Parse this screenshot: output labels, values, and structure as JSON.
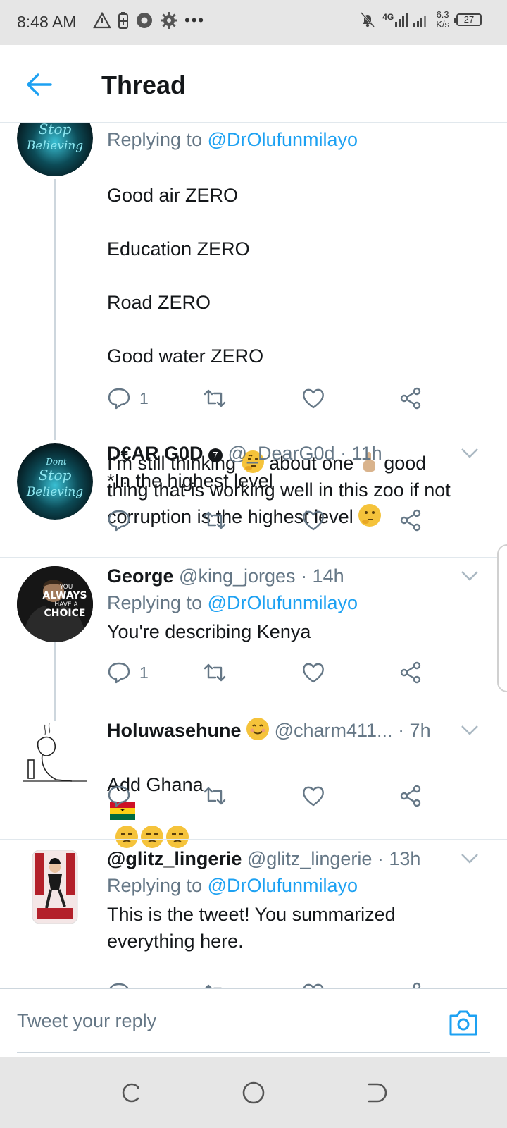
{
  "status_bar": {
    "time": "8:48 AM",
    "network": "4G",
    "speed_value": "6.3",
    "speed_unit": "K/s",
    "battery": "27"
  },
  "header": {
    "title": "Thread"
  },
  "tweets": [
    {
      "reply_prefix": "Replying to",
      "reply_handle": "@DrOlufunmilayo",
      "lines": [
        "Good air ZERO",
        "Education ZERO",
        "Road ZERO",
        "Good water ZERO"
      ],
      "para_a": "I’m still thinking",
      "para_b": "about one",
      "para_c": "good thing that is working well in this zoo if not corruption is the highest level",
      "reply_count": "1"
    },
    {
      "name": "D€AR G0D",
      "handle": "@_DearG0d",
      "time": "· 11h",
      "text": "*In the highest level",
      "reply_count": ""
    },
    {
      "name": "George",
      "handle": "@king_jorges",
      "time": "· 14h",
      "reply_prefix": "Replying to",
      "reply_handle": "@DrOlufunmilayo",
      "text": "You're describing Kenya",
      "reply_count": "1",
      "avatar_text": [
        "YOU",
        "ALWAYS",
        "HAVE A",
        "CHOICE"
      ]
    },
    {
      "name": "Holuwasehune",
      "handle": "@charm411...",
      "time": "· 7h",
      "text": "Add Ghana",
      "reply_count": ""
    },
    {
      "name": "@glitz_lingerie",
      "handle": "@glitz_lingerie",
      "time": "· 13h",
      "reply_prefix": "Replying to",
      "reply_handle": "@DrOlufunmilayo",
      "text": "This is the tweet! You summarized everything here."
    }
  ],
  "avatar_logo": [
    "Dont",
    "Stop",
    "Believing"
  ],
  "composer": {
    "placeholder": "Tweet your reply"
  },
  "colors": {
    "accent": "#1da1f2",
    "muted": "#657786",
    "text": "#14171a"
  }
}
